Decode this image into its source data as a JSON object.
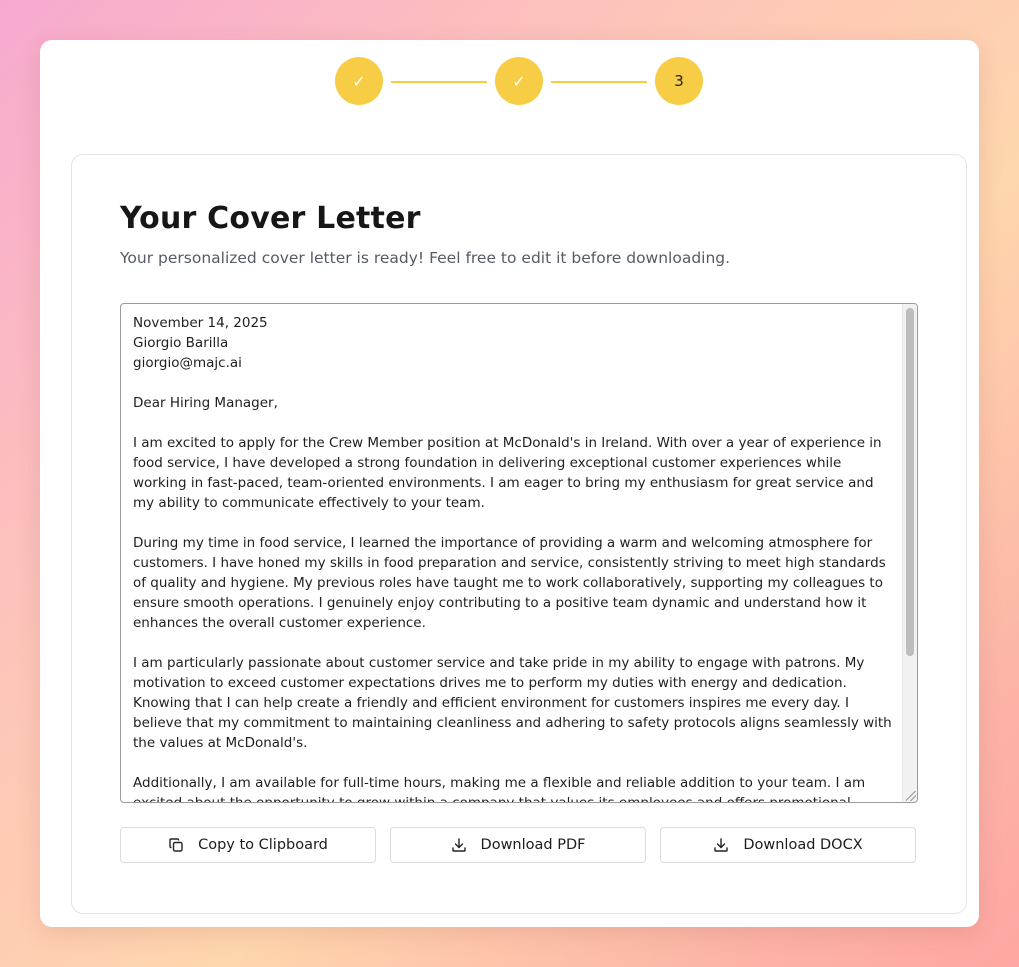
{
  "stepper": {
    "steps": [
      {
        "label": "✓",
        "state": "complete"
      },
      {
        "label": "✓",
        "state": "complete"
      },
      {
        "label": "3",
        "state": "current"
      }
    ],
    "accent_color": "#f6cd45"
  },
  "card": {
    "title": "Your Cover Letter",
    "subtitle": "Your personalized cover letter is ready! Feel free to edit it before downloading."
  },
  "letter": {
    "text": "November 14, 2025\nGiorgio Barilla\ngiorgio@majc.ai\n\nDear Hiring Manager,\n\nI am excited to apply for the Crew Member position at McDonald's in Ireland. With over a year of experience in food service, I have developed a strong foundation in delivering exceptional customer experiences while working in fast-paced, team-oriented environments. I am eager to bring my enthusiasm for great service and my ability to communicate effectively to your team.\n\nDuring my time in food service, I learned the importance of providing a warm and welcoming atmosphere for customers. I have honed my skills in food preparation and service, consistently striving to meet high standards of quality and hygiene. My previous roles have taught me to work collaboratively, supporting my colleagues to ensure smooth operations. I genuinely enjoy contributing to a positive team dynamic and understand how it enhances the overall customer experience.\n\nI am particularly passionate about customer service and take pride in my ability to engage with patrons. My motivation to exceed customer expectations drives me to perform my duties with energy and dedication. Knowing that I can help create a friendly and efficient environment for customers inspires me every day. I believe that my commitment to maintaining cleanliness and adhering to safety protocols aligns seamlessly with the values at McDonald's.\n\nAdditionally, I am available for full-time hours, making me a flexible and reliable addition to your team. I am excited about the opportunity to grow within a company that values its employees and offers promotional"
  },
  "actions": {
    "copy": {
      "label": "Copy to Clipboard",
      "icon": "copy-icon"
    },
    "pdf": {
      "label": "Download PDF",
      "icon": "download-icon"
    },
    "docx": {
      "label": "Download DOCX",
      "icon": "download-icon"
    }
  }
}
